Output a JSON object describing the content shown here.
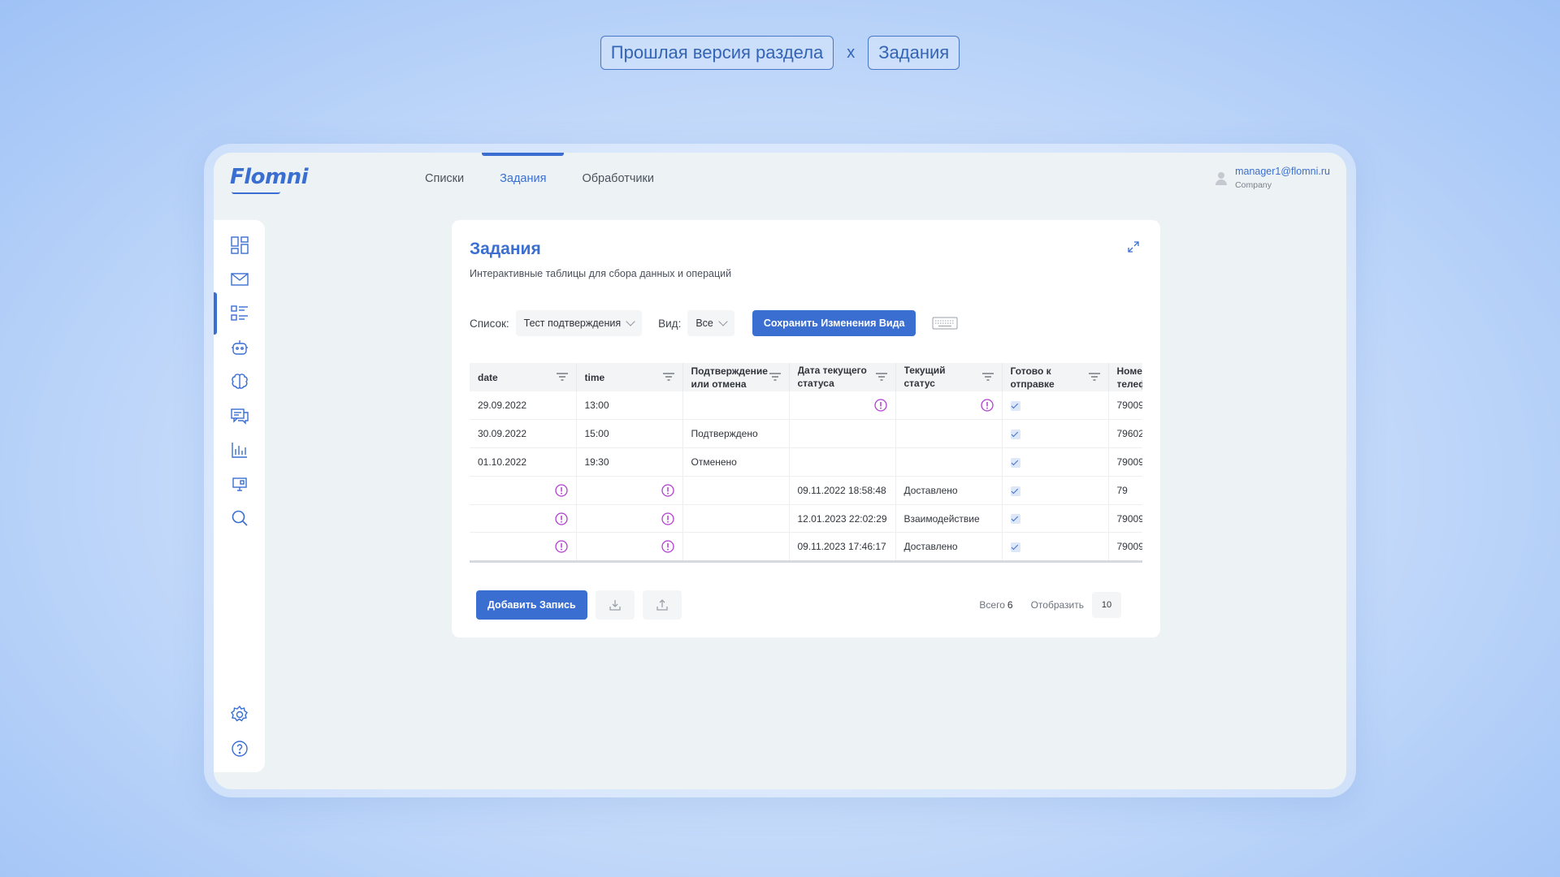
{
  "caption": {
    "left_label": "Прошлая версия раздела",
    "separator": "x",
    "right_label": "Задания"
  },
  "app": {
    "logo_text": "Flomni",
    "nav_tabs": [
      {
        "label": "Списки",
        "active": false
      },
      {
        "label": "Задания",
        "active": true
      },
      {
        "label": "Обработчики",
        "active": false
      }
    ],
    "user": {
      "email": "manager1@flomni.ru",
      "company": "Company"
    },
    "accent_color": "#3a6ed0",
    "sidebar_icons": [
      "dashboard-icon",
      "mail-icon",
      "tasks-list-icon",
      "bot-icon",
      "brain-icon",
      "chat-icon",
      "analytics-icon",
      "monitor-icon",
      "search-icon",
      "settings-icon",
      "help-icon"
    ]
  },
  "card": {
    "title": "Задания",
    "subtitle": "Интерактивные таблицы для сбора данных и операций",
    "toolbar": {
      "list_label": "Список:",
      "list_value": "Тест подтверждения",
      "view_label": "Вид:",
      "view_value": "Все",
      "save_button": "Сохранить Изменения Вида"
    },
    "table": {
      "columns": [
        "date",
        "time",
        "Подтверждение или отмена",
        "Дата текущего статуса сообщения",
        "Текущий статус сообщения",
        "Готово к отправке",
        "Номер телефона"
      ],
      "rows": [
        {
          "date": "29.09.2022",
          "time": "13:00",
          "confirm": "",
          "status_date": "",
          "status": "",
          "ready": true,
          "phone": "79009"
        },
        {
          "date": "30.09.2022",
          "time": "15:00",
          "confirm": "Подтверждено",
          "status_date": "",
          "status": "",
          "ready": true,
          "phone": "79602"
        },
        {
          "date": "01.10.2022",
          "time": "19:30",
          "confirm": "Отменено",
          "status_date": "",
          "status": "",
          "ready": true,
          "phone": "79009"
        },
        {
          "date": "",
          "time": "",
          "confirm": "",
          "status_date": "09.11.2022 18:58:48",
          "status": "Доставлено",
          "ready": true,
          "phone": "79"
        },
        {
          "date": "",
          "time": "",
          "confirm": "",
          "status_date": "12.01.2023 22:02:29",
          "status": "Взаимодействие",
          "ready": true,
          "phone": "79009"
        },
        {
          "date": "",
          "time": "",
          "confirm": "",
          "status_date": "09.11.2023 17:46:17",
          "status": "Доставлено",
          "ready": true,
          "phone": "79009"
        }
      ]
    },
    "footer": {
      "add_button": "Добавить Запись",
      "total_label": "Всего",
      "total_value": "6",
      "show_label": "Отобразить",
      "show_value": "10"
    }
  }
}
